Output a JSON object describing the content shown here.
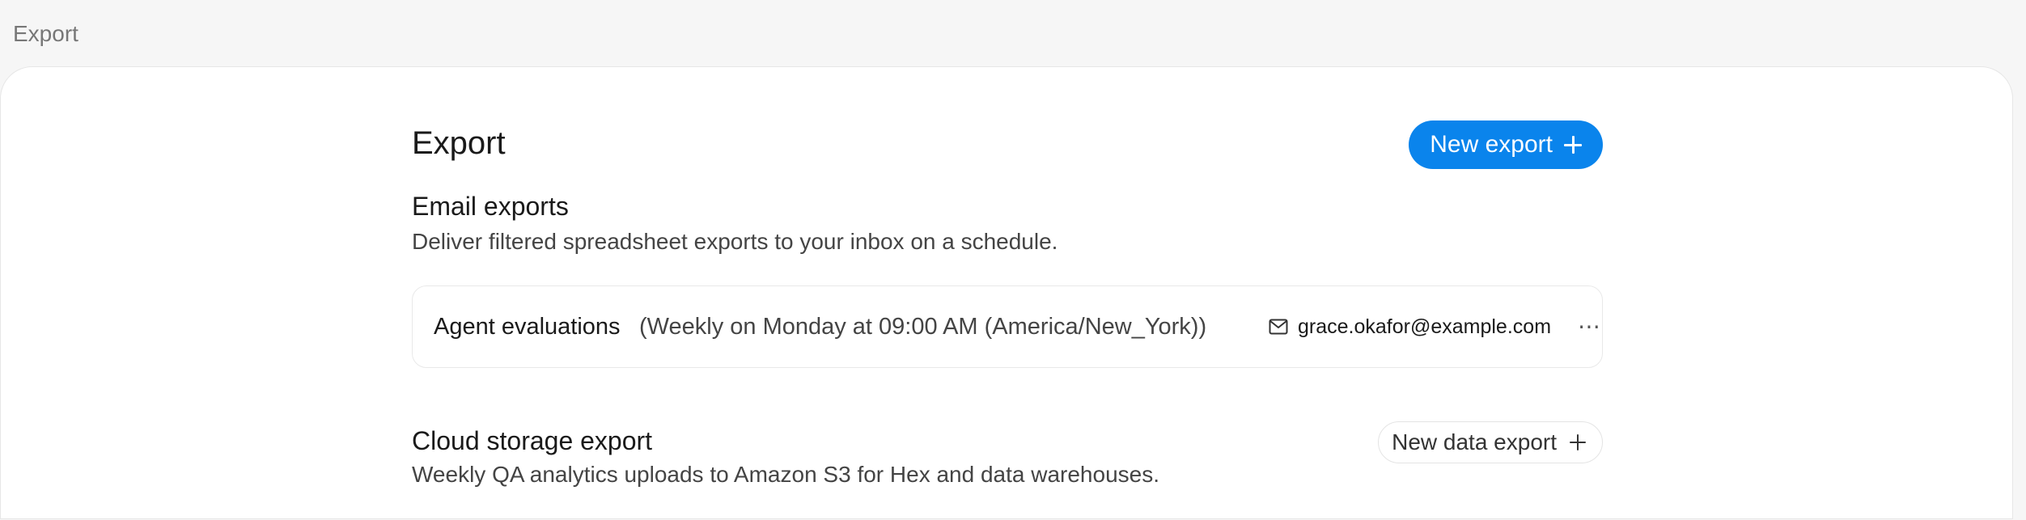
{
  "topbar": {
    "title": "Export"
  },
  "main": {
    "title": "Export",
    "new_export_label": "New export",
    "email_exports": {
      "title": "Email exports",
      "description": "Deliver filtered spreadsheet exports to your inbox on a schedule.",
      "items": [
        {
          "name": "Agent evaluations",
          "schedule": "(Weekly on Monday at 09:00 AM (America/New_York))",
          "email": "grace.okafor@example.com",
          "more": "⋯"
        }
      ]
    },
    "cloud_storage": {
      "title": "Cloud storage export",
      "description": "Weekly QA analytics uploads to Amazon S3 for Hex and data warehouses.",
      "new_data_export_label": "New data export"
    }
  },
  "colors": {
    "primary": "#0a84ec",
    "background": "#f6f6f6",
    "panel": "#ffffff"
  },
  "icons": {
    "plus": "plus-icon",
    "mail": "mail-icon",
    "more": "more-icon"
  }
}
